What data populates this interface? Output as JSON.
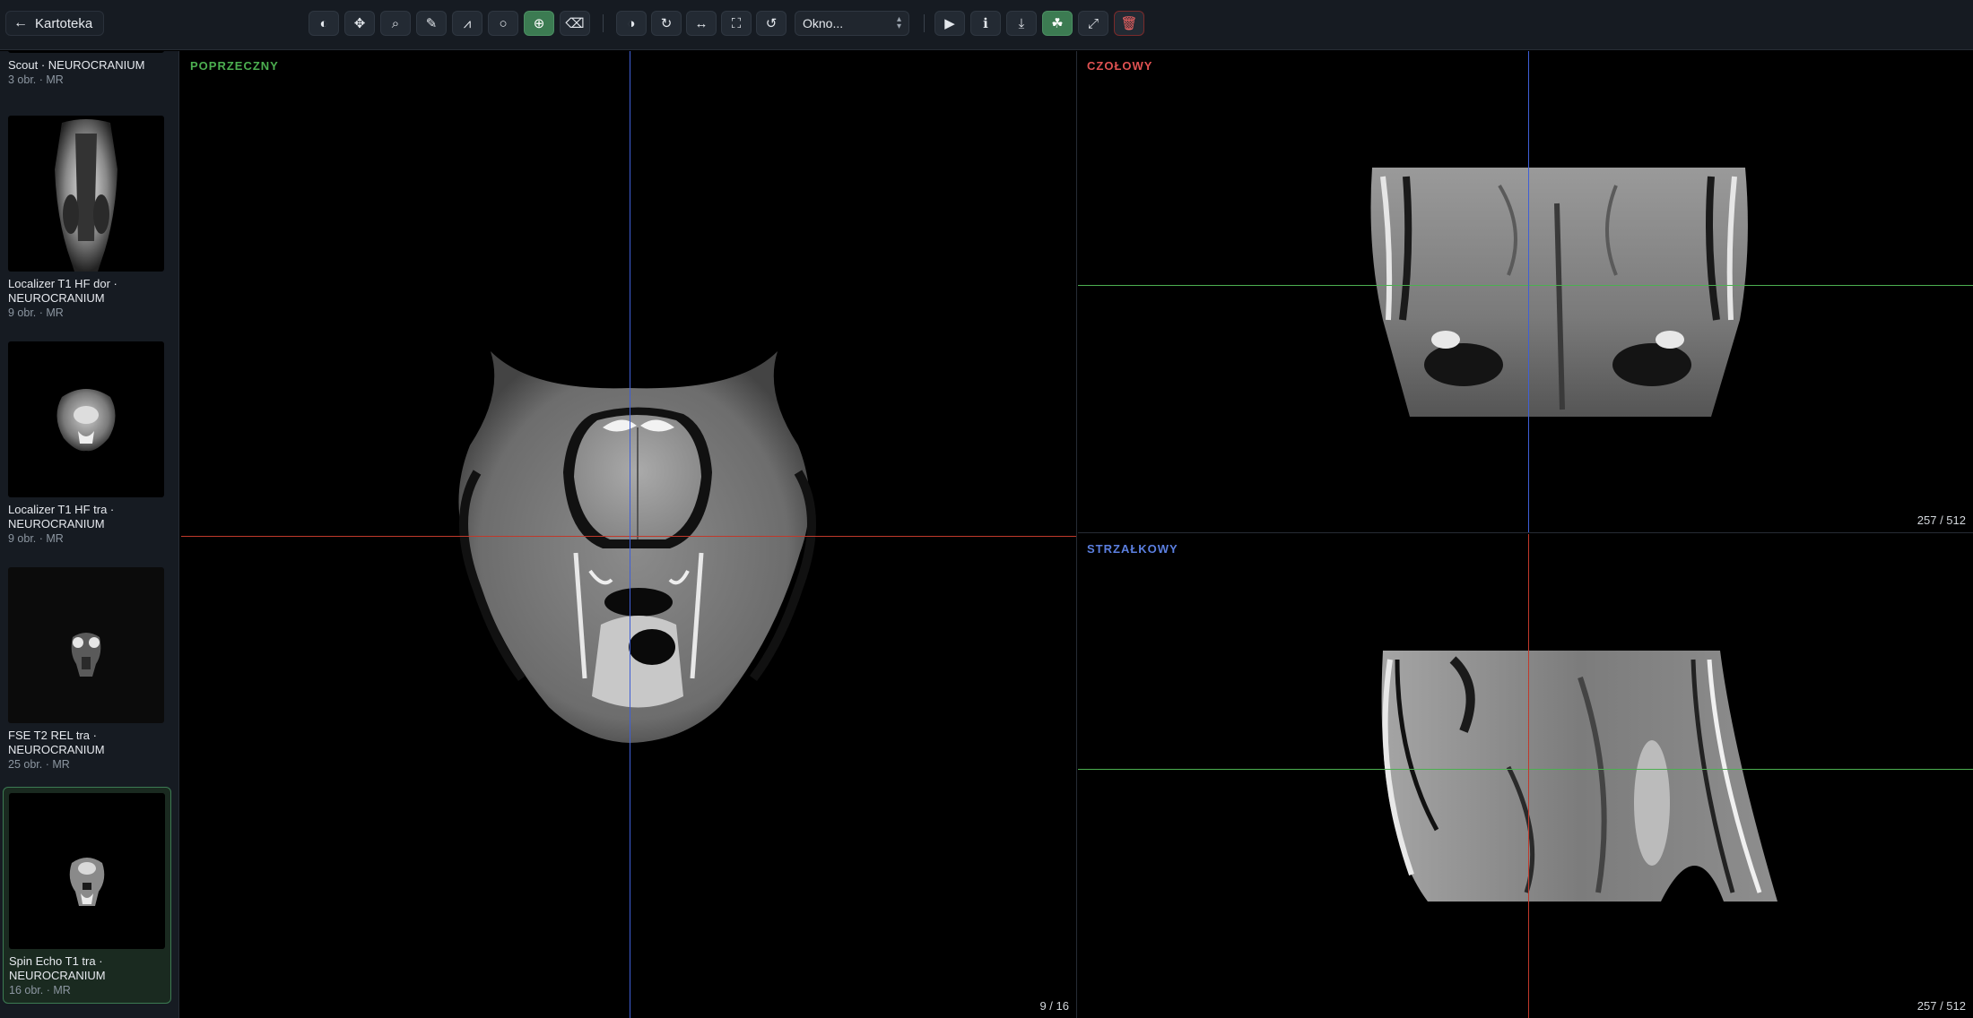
{
  "toolbar": {
    "back_label": "Kartoteka",
    "tools": [
      {
        "icon": "contrast-half-icon",
        "glyph": "◐",
        "active": false
      },
      {
        "icon": "move-icon",
        "glyph": "✥",
        "active": false
      },
      {
        "icon": "zoom-icon",
        "glyph": "⌕",
        "active": false
      },
      {
        "icon": "ruler-icon",
        "glyph": "✎",
        "active": false
      },
      {
        "icon": "angle-icon",
        "glyph": "⩘",
        "active": false
      },
      {
        "icon": "ellipse-icon",
        "glyph": "○",
        "active": false
      },
      {
        "icon": "crosshair-icon",
        "glyph": "⊕",
        "active": true
      },
      {
        "icon": "eraser-icon",
        "glyph": "⌫",
        "active": false
      }
    ],
    "view_tools": [
      {
        "icon": "invert-icon",
        "glyph": "◑"
      },
      {
        "icon": "rotate-right-icon",
        "glyph": "↻"
      },
      {
        "icon": "flip-horizontal-icon",
        "glyph": "↔"
      },
      {
        "icon": "fit-icon",
        "glyph": "⛶"
      },
      {
        "icon": "reset-icon",
        "glyph": "↺"
      }
    ],
    "window_select": "Okno...",
    "action_tools": [
      {
        "icon": "play-icon",
        "glyph": "▶",
        "state": "normal"
      },
      {
        "icon": "info-icon",
        "glyph": "ℹ",
        "state": "normal"
      },
      {
        "icon": "download-icon",
        "glyph": "⤓",
        "state": "normal"
      },
      {
        "icon": "mpr-icon",
        "glyph": "☘",
        "state": "active"
      },
      {
        "icon": "fullscreen-icon",
        "glyph": "⤢",
        "state": "normal"
      },
      {
        "icon": "trash-icon",
        "glyph": "🗑",
        "state": "danger"
      }
    ]
  },
  "sidebar": {
    "series": [
      {
        "title": "Scout · NEUROCRANIUM",
        "meta": "3 obr. · MR"
      },
      {
        "title": "Localizer T1 HF dor · NEUROCRANIUM",
        "meta": "9 obr. · MR"
      },
      {
        "title": "Localizer T1 HF tra · NEUROCRANIUM",
        "meta": "9 obr. · MR"
      },
      {
        "title": "FSE T2 REL tra · NEUROCRANIUM",
        "meta": "25 obr. · MR"
      },
      {
        "title": "Spin Echo T1 tra · NEUROCRANIUM",
        "meta": "16 obr. · MR"
      }
    ]
  },
  "viewports": {
    "axial": {
      "label": "POPRZECZNY",
      "count": "9 / 16",
      "color": "#4caf50"
    },
    "coronal": {
      "label": "CZOŁOWY",
      "count": "257 / 512",
      "color": "#e05252"
    },
    "sagittal": {
      "label": "STRZAŁKOWY",
      "count": "257 / 512",
      "color": "#5b7fe0"
    }
  },
  "colors": {
    "active_tool": "#3c7b52",
    "axial": "#4caf50",
    "coronal": "#e05252",
    "sagittal": "#5b7fe0"
  }
}
